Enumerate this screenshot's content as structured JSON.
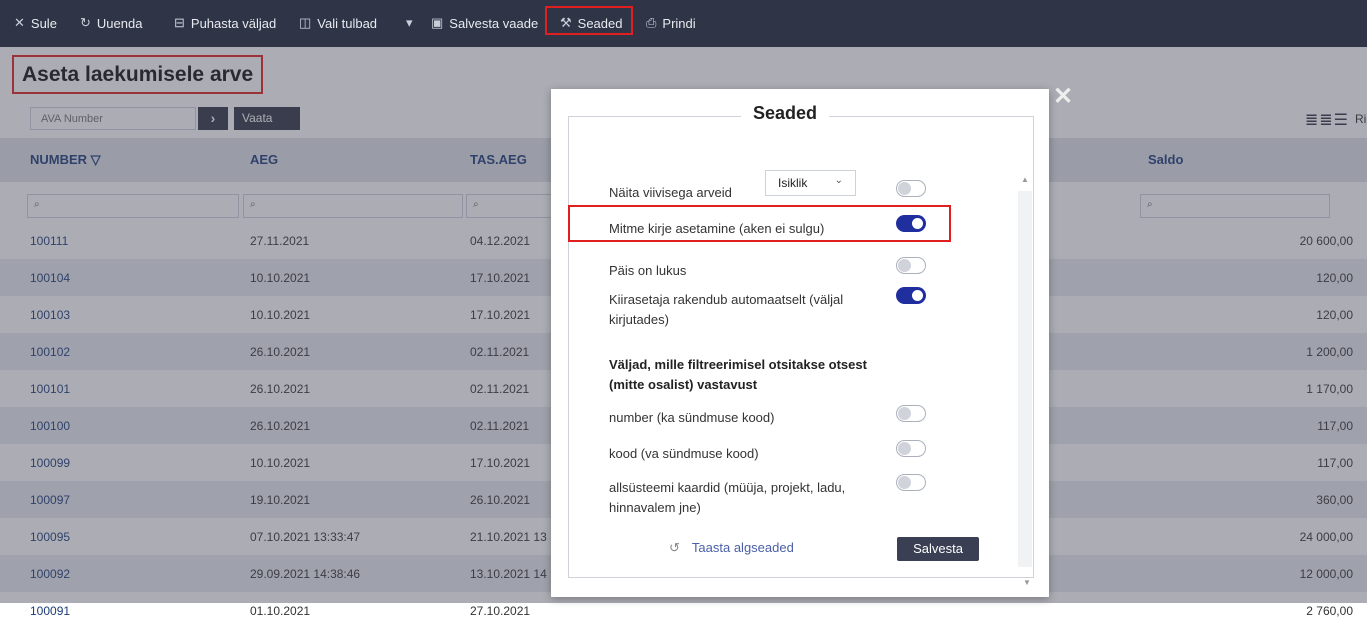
{
  "toolbar": {
    "items": [
      {
        "icon": "✕",
        "label": "Sule"
      },
      {
        "icon": "↻",
        "label": "Uuenda"
      },
      {
        "icon": "⊟",
        "label": "Puhasta väljad"
      },
      {
        "icon": "◫",
        "label": "Vali tulbad"
      },
      {
        "icon": "▾",
        "label": ""
      },
      {
        "icon": "▣",
        "label": "Salvesta vaade"
      },
      {
        "icon": "⚒",
        "label": "Seaded"
      },
      {
        "icon": "⎙",
        "label": "Prindi"
      }
    ]
  },
  "page": {
    "title": "Aseta laekumisele arve"
  },
  "search": {
    "placeholder": "AVA Number",
    "go_label": "›",
    "view_label": "Vaata"
  },
  "view": {
    "icons": "≣≣☰",
    "label": "Ri"
  },
  "table": {
    "columns": [
      "NUMBER ▽",
      "AEG",
      "TAS.AEG",
      "Saldo"
    ],
    "filter_icon": "⌕",
    "rows": [
      {
        "number": "100111",
        "aeg": "27.11.2021",
        "tas": "04.12.2021",
        "saldo": "20 600,00"
      },
      {
        "number": "100104",
        "aeg": "10.10.2021",
        "tas": "17.10.2021",
        "saldo": "120,00"
      },
      {
        "number": "100103",
        "aeg": "10.10.2021",
        "tas": "17.10.2021",
        "saldo": "120,00"
      },
      {
        "number": "100102",
        "aeg": "26.10.2021",
        "tas": "02.11.2021",
        "saldo": "1 200,00"
      },
      {
        "number": "100101",
        "aeg": "26.10.2021",
        "tas": "02.11.2021",
        "saldo": "1 170,00"
      },
      {
        "number": "100100",
        "aeg": "26.10.2021",
        "tas": "02.11.2021",
        "saldo": "117,00"
      },
      {
        "number": "100099",
        "aeg": "10.10.2021",
        "tas": "17.10.2021",
        "saldo": "117,00"
      },
      {
        "number": "100097",
        "aeg": "19.10.2021",
        "tas": "26.10.2021",
        "saldo": "360,00"
      },
      {
        "number": "100095",
        "aeg": "07.10.2021 13:33:47",
        "tas": "21.10.2021 13",
        "saldo": "24 000,00"
      },
      {
        "number": "100092",
        "aeg": "29.09.2021 14:38:46",
        "tas": "13.10.2021 14",
        "saldo": "12 000,00"
      },
      {
        "number": "100091",
        "aeg": "01.10.2021",
        "tas": "27.10.2021",
        "saldo": "2 760,00"
      }
    ]
  },
  "modal": {
    "close": "✕",
    "title": "Seaded",
    "select_value": "Isiklik",
    "select_chevron": "⌄",
    "options": [
      {
        "label": "Näita viivisega arveid",
        "on": false
      },
      {
        "label": "Mitme kirje asetamine (aken ei sulgu)",
        "on": true
      },
      {
        "label": "Päis on lukus",
        "on": false
      },
      {
        "label": "Kiirasetaja rakendub automaatselt (väljal kirjutades)",
        "on": true
      }
    ],
    "section_heading": "Väljad, mille filtreerimisel otsitakse otsest (mitte osalist) vastavust",
    "exact_options": [
      {
        "label": "number (ka sündmuse kood)",
        "on": false
      },
      {
        "label": "kood (va sündmuse kood)",
        "on": false
      },
      {
        "label": "allsüsteemi kaardid (müüja, projekt, ladu, hinnavalem jne)",
        "on": false
      }
    ],
    "reset_icon": "↺",
    "reset_label": "Taasta algseaded",
    "save_label": "Salvesta"
  }
}
